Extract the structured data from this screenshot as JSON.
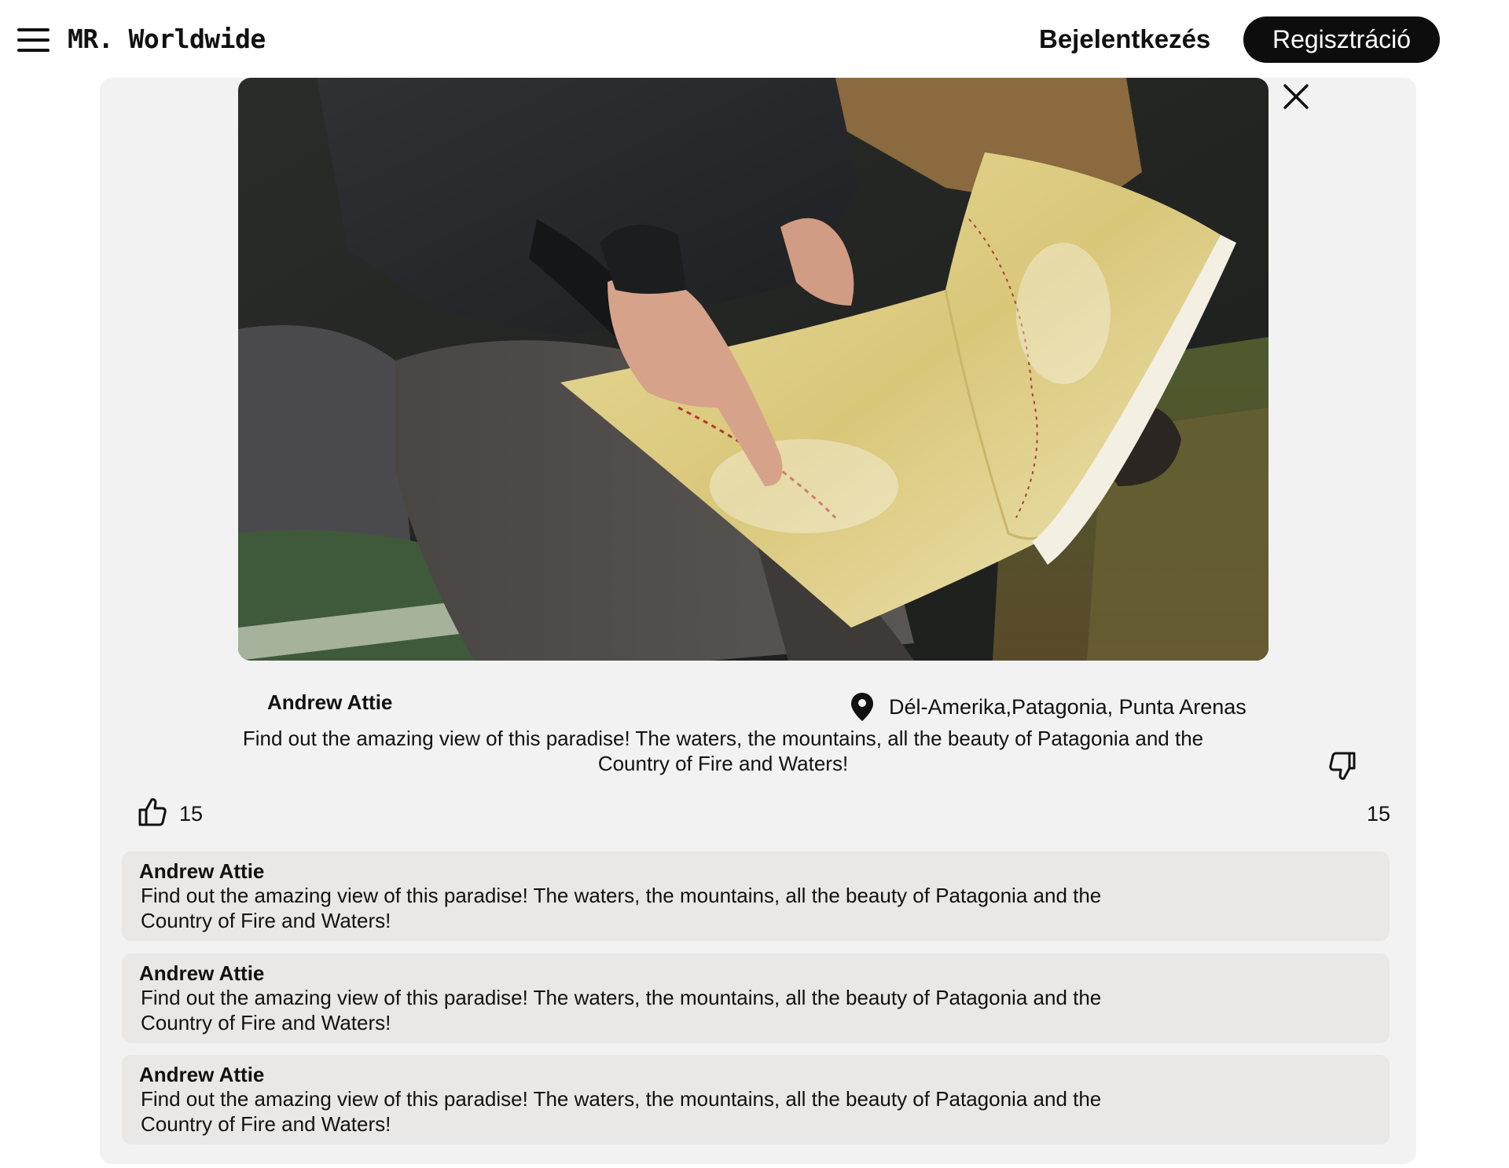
{
  "header": {
    "brand": "MR. Worldwide",
    "login_label": "Bejelentkezés",
    "register_label": "Regisztráció"
  },
  "post": {
    "author": "Andrew Attie",
    "location": "Dél-Amerika,Patagonia, Punta Arenas",
    "description": "Find out the amazing view of this paradise! The waters, the mountains, all the beauty of Patagonia and the Country of Fire and Waters!",
    "likes": "15",
    "dislikes": "15"
  },
  "comments": [
    {
      "author": "Andrew Attie",
      "text": "Find out the amazing view of this paradise! The waters, the mountains, all the beauty of Patagonia and the Country of Fire and Waters!"
    },
    {
      "author": "Andrew Attie",
      "text": "Find out the amazing view of this paradise! The waters, the mountains, all the beauty of Patagonia and the Country of Fire and Waters!"
    },
    {
      "author": "Andrew Attie",
      "text": "Find out the amazing view of this paradise! The waters, the mountains, all the beauty of Patagonia and the Country of Fire and Waters!"
    }
  ],
  "icons": {
    "menu": "hamburger-menu-icon",
    "close": "close-icon",
    "location": "map-pin-icon",
    "like": "thumbs-up-icon",
    "dislike": "thumbs-down-icon"
  }
}
